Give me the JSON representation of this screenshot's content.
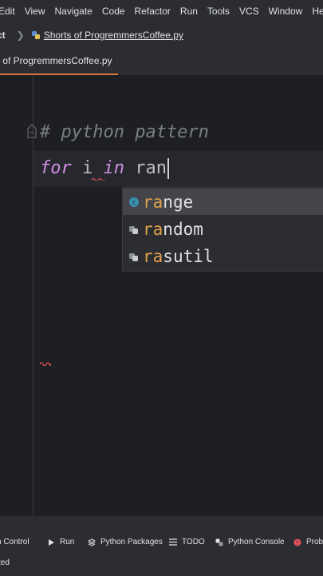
{
  "menu": [
    "Edit",
    "View",
    "Navigate",
    "Code",
    "Refactor",
    "Run",
    "Tools",
    "VCS",
    "Window",
    "Help"
  ],
  "breadcrumb": {
    "project": "ct",
    "file": "Shorts of ProgremmersCoffee.py"
  },
  "tab": {
    "label": "s of ProgremmersCoffee.py",
    "close": "×"
  },
  "editor": {
    "comment": "# python pattern",
    "line2": {
      "kw_for": "for",
      "var": "i",
      "kw_in": "in",
      "typed": "ran"
    }
  },
  "completion": [
    {
      "icon": "class-c-icon",
      "match": "ra",
      "rest": "nge",
      "selected": true
    },
    {
      "icon": "package-icon",
      "match": "ra",
      "rest": "ndom",
      "selected": false
    },
    {
      "icon": "package-icon",
      "match": "ra",
      "rest": "sutil",
      "selected": false
    }
  ],
  "toolwindows": [
    "n Control",
    "Run",
    "Python Packages",
    "TODO",
    "Python Console",
    "Probl"
  ],
  "status": {
    "message": "ted"
  },
  "colors": {
    "accent_tab": "#d87a3e",
    "keyword": "#cf8ee0",
    "match": "#e0a04b",
    "error": "#e4525a"
  }
}
